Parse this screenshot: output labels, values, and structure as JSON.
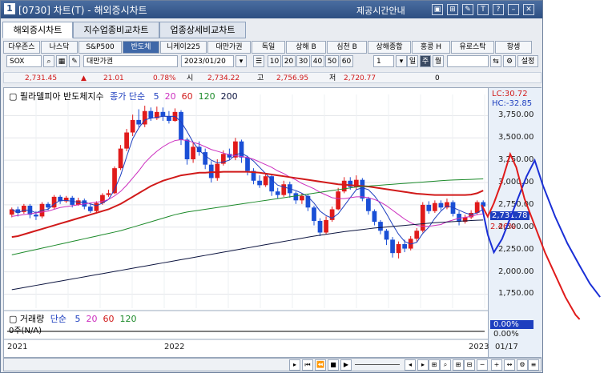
{
  "titlebar": {
    "num": "1",
    "title": "[0730] 차트(T) - 해외증시차트",
    "info": "제공시간안내",
    "icons": [
      "restore-icon",
      "link-icon",
      "tool-icon",
      "text-icon",
      "help-icon",
      "minimize-icon",
      "close-icon"
    ],
    "icon_glyphs": [
      "▣",
      "⊞",
      "✎",
      "T",
      "?",
      "–",
      "✕"
    ]
  },
  "tabs": [
    "해외증시차트",
    "지수업종비교차트",
    "업종상세비교차트"
  ],
  "markets": [
    "다우존스",
    "나스닥",
    "S&P500",
    "반도체",
    "니케이225",
    "대만가권",
    "독일",
    "상해 B",
    "심천 B",
    "상해종합",
    "홍콩 H",
    "유로스탁",
    "항셍"
  ],
  "selected_market": "반도체",
  "controls": {
    "symbol": "SOX",
    "name": "대만가권",
    "date": "2023/01/20",
    "periods": [
      "10",
      "20",
      "30",
      "40",
      "50",
      "60"
    ],
    "count": "1",
    "day": "일",
    "week": "주",
    "month": "월"
  },
  "quote": {
    "price": "2,731.45",
    "arrow": "▲",
    "change": "21.01",
    "rate": "0.78%",
    "open_label": "시",
    "open": "2,734.22",
    "high_label": "고",
    "high": "2,756.95",
    "low_label": "저",
    "low": "2,720.77",
    "volume": "0"
  },
  "legend": {
    "title": "필라델피아 반도체지수",
    "type": "종가 단순",
    "ma": [
      "5",
      "20",
      "60",
      "120",
      "200"
    ],
    "ma_colors": [
      "#1e3fbf",
      "#cc2fbf",
      "#d11a1a",
      "#1c8a2a",
      "#0d1540"
    ]
  },
  "axis_labels": {
    "lc": "LC:30.72",
    "hc": "HC:-32.85",
    "price_tag": "2,731.78",
    "pct_tag": "2.46%",
    "vol_pct": "0.00%",
    "vol_pct2": "0.00%",
    "date_tag": "01/17"
  },
  "y_ticks": [
    "3,750.00",
    "3,500.00",
    "3,250.00",
    "3,000.00",
    "2,750.00",
    "2,500.00",
    "2,250.00",
    "2,000.00",
    "1,750.00"
  ],
  "x_ticks": [
    "2021",
    "2022",
    "2023"
  ],
  "volume_legend": {
    "title": "거래량",
    "type": "단순",
    "ma": [
      "5",
      "20",
      "60",
      "120"
    ],
    "value": "0주(N/A)"
  },
  "chart_data": {
    "type": "candlestick",
    "title": "필라델피아 반도체지수",
    "y_range": [
      1620,
      3950
    ],
    "candles": [
      [
        2640,
        2700,
        2610,
        2720
      ],
      [
        2700,
        2660,
        2620,
        2730
      ],
      [
        2670,
        2740,
        2650,
        2760
      ],
      [
        2740,
        2640,
        2600,
        2760
      ],
      [
        2640,
        2620,
        2580,
        2680
      ],
      [
        2620,
        2760,
        2600,
        2780
      ],
      [
        2760,
        2720,
        2690,
        2780
      ],
      [
        2720,
        2840,
        2700,
        2860
      ],
      [
        2840,
        2790,
        2760,
        2860
      ],
      [
        2790,
        2830,
        2770,
        2850
      ],
      [
        2830,
        2750,
        2720,
        2850
      ],
      [
        2750,
        2800,
        2740,
        2830
      ],
      [
        2800,
        2730,
        2700,
        2820
      ],
      [
        2730,
        2680,
        2660,
        2760
      ],
      [
        2680,
        2770,
        2660,
        2790
      ],
      [
        2770,
        2860,
        2750,
        2880
      ],
      [
        2860,
        2880,
        2840,
        2920
      ],
      [
        2880,
        3160,
        2870,
        3180
      ],
      [
        3160,
        3380,
        3140,
        3420
      ],
      [
        3380,
        3560,
        3350,
        3600
      ],
      [
        3560,
        3700,
        3520,
        3760
      ],
      [
        3700,
        3650,
        3620,
        3820
      ],
      [
        3650,
        3800,
        3620,
        3860
      ],
      [
        3800,
        3720,
        3690,
        3840
      ],
      [
        3720,
        3790,
        3700,
        3850
      ],
      [
        3790,
        3740,
        3690,
        3840
      ],
      [
        3740,
        3690,
        3660,
        3800
      ],
      [
        3690,
        3790,
        3680,
        3830
      ],
      [
        3790,
        3480,
        3420,
        3810
      ],
      [
        3480,
        3260,
        3200,
        3500
      ],
      [
        3260,
        3400,
        3220,
        3450
      ],
      [
        3400,
        3340,
        3300,
        3460
      ],
      [
        3340,
        3200,
        3150,
        3380
      ],
      [
        3200,
        3050,
        3000,
        3240
      ],
      [
        3050,
        3210,
        3020,
        3260
      ],
      [
        3210,
        3320,
        3190,
        3360
      ],
      [
        3320,
        3280,
        3250,
        3380
      ],
      [
        3280,
        3460,
        3250,
        3500
      ],
      [
        3460,
        3280,
        3220,
        3480
      ],
      [
        3280,
        3130,
        3080,
        3300
      ],
      [
        3130,
        3020,
        2980,
        3160
      ],
      [
        3020,
        2970,
        2940,
        3080
      ],
      [
        2970,
        3070,
        2950,
        3100
      ],
      [
        3070,
        2900,
        2850,
        3090
      ],
      [
        2900,
        2860,
        2820,
        2940
      ],
      [
        2860,
        2980,
        2840,
        3020
      ],
      [
        2980,
        2880,
        2830,
        3010
      ],
      [
        2880,
        2800,
        2760,
        2900
      ],
      [
        2800,
        2850,
        2760,
        2880
      ],
      [
        2850,
        2720,
        2680,
        2870
      ],
      [
        2720,
        2570,
        2520,
        2740
      ],
      [
        2570,
        2440,
        2400,
        2600
      ],
      [
        2440,
        2580,
        2420,
        2620
      ],
      [
        2580,
        2700,
        2560,
        2730
      ],
      [
        2700,
        2900,
        2690,
        2940
      ],
      [
        2900,
        3020,
        2880,
        3060
      ],
      [
        3020,
        2950,
        2920,
        3060
      ],
      [
        2950,
        3030,
        2920,
        3080
      ],
      [
        3030,
        2820,
        2790,
        3050
      ],
      [
        2820,
        2680,
        2640,
        2840
      ],
      [
        2680,
        2560,
        2520,
        2700
      ],
      [
        2560,
        2460,
        2420,
        2580
      ],
      [
        2460,
        2360,
        2300,
        2480
      ],
      [
        2360,
        2210,
        2160,
        2390
      ],
      [
        2210,
        2310,
        2150,
        2340
      ],
      [
        2310,
        2260,
        2220,
        2360
      ],
      [
        2260,
        2370,
        2240,
        2400
      ],
      [
        2370,
        2460,
        2340,
        2490
      ],
      [
        2460,
        2750,
        2440,
        2780
      ],
      [
        2750,
        2680,
        2650,
        2790
      ],
      [
        2680,
        2770,
        2660,
        2800
      ],
      [
        2770,
        2720,
        2690,
        2800
      ],
      [
        2720,
        2780,
        2700,
        2820
      ],
      [
        2780,
        2650,
        2620,
        2800
      ],
      [
        2650,
        2560,
        2520,
        2680
      ],
      [
        2560,
        2610,
        2540,
        2640
      ],
      [
        2610,
        2660,
        2590,
        2690
      ],
      [
        2660,
        2780,
        2640,
        2800
      ],
      [
        2780,
        2731,
        2720,
        2800
      ]
    ],
    "ma_series": {
      "ma5": [
        2700,
        2660,
        2690,
        2690,
        2660,
        2690,
        2700,
        2760,
        2800,
        2800,
        2790,
        2780,
        2780,
        2760,
        2740,
        2770,
        2810,
        2920,
        3080,
        3290,
        3490,
        3610,
        3700,
        3720,
        3730,
        3740,
        3740,
        3740,
        3680,
        3570,
        3450,
        3360,
        3300,
        3250,
        3220,
        3230,
        3250,
        3310,
        3330,
        3290,
        3240,
        3170,
        3100,
        3030,
        2970,
        2950,
        2930,
        2910,
        2880,
        2840,
        2770,
        2680,
        2630,
        2600,
        2650,
        2740,
        2830,
        2920,
        2940,
        2920,
        2850,
        2760,
        2650,
        2530,
        2420,
        2340,
        2310,
        2330,
        2430,
        2500,
        2600,
        2680,
        2740,
        2720,
        2690,
        2660,
        2640,
        2660,
        2700
      ],
      "ma20": [
        2620,
        2630,
        2640,
        2650,
        2660,
        2670,
        2680,
        2700,
        2720,
        2730,
        2740,
        2750,
        2760,
        2770,
        2780,
        2790,
        2810,
        2850,
        2900,
        2970,
        3050,
        3130,
        3220,
        3290,
        3350,
        3400,
        3440,
        3470,
        3480,
        3470,
        3450,
        3430,
        3400,
        3370,
        3350,
        3330,
        3310,
        3300,
        3290,
        3280,
        3260,
        3230,
        3200,
        3170,
        3130,
        3100,
        3060,
        3030,
        2990,
        2960,
        2930,
        2890,
        2860,
        2830,
        2820,
        2820,
        2830,
        2840,
        2840,
        2830,
        2810,
        2780,
        2740,
        2690,
        2640,
        2590,
        2550,
        2520,
        2510,
        2510,
        2520,
        2530,
        2560,
        2580,
        2600,
        2610,
        2620,
        2640,
        2650
      ],
      "ma60": [
        2390,
        2400,
        2420,
        2440,
        2460,
        2480,
        2500,
        2520,
        2540,
        2560,
        2580,
        2600,
        2620,
        2640,
        2660,
        2680,
        2700,
        2730,
        2760,
        2800,
        2840,
        2880,
        2920,
        2960,
        2990,
        3020,
        3040,
        3060,
        3080,
        3090,
        3100,
        3110,
        3110,
        3115,
        3115,
        3120,
        3120,
        3120,
        3120,
        3120,
        3115,
        3110,
        3100,
        3090,
        3080,
        3070,
        3060,
        3050,
        3040,
        3030,
        3020,
        3010,
        3000,
        2990,
        2980,
        2975,
        2970,
        2965,
        2960,
        2955,
        2945,
        2935,
        2925,
        2915,
        2905,
        2895,
        2885,
        2875,
        2870,
        2865,
        2860,
        2860,
        2860,
        2860,
        2860,
        2860,
        2865,
        2880,
        2910
      ],
      "ma120": [
        2190,
        2205,
        2220,
        2235,
        2250,
        2265,
        2280,
        2295,
        2310,
        2325,
        2340,
        2355,
        2370,
        2385,
        2400,
        2415,
        2430,
        2445,
        2460,
        2480,
        2500,
        2520,
        2540,
        2560,
        2580,
        2600,
        2620,
        2640,
        2655,
        2670,
        2680,
        2690,
        2700,
        2710,
        2720,
        2730,
        2740,
        2750,
        2760,
        2770,
        2780,
        2790,
        2800,
        2810,
        2820,
        2830,
        2840,
        2850,
        2860,
        2870,
        2880,
        2890,
        2900,
        2910,
        2920,
        2930,
        2940,
        2950,
        2955,
        2960,
        2965,
        2970,
        2975,
        2980,
        2985,
        2990,
        2995,
        3000,
        3005,
        3010,
        3015,
        3020,
        3025,
        3028,
        3030,
        3033,
        3035,
        3038,
        3040
      ],
      "ma200": [
        1800,
        1812,
        1824,
        1836,
        1848,
        1860,
        1872,
        1884,
        1896,
        1908,
        1920,
        1932,
        1944,
        1956,
        1968,
        1980,
        1992,
        2004,
        2016,
        2028,
        2040,
        2052,
        2064,
        2076,
        2088,
        2100,
        2112,
        2124,
        2136,
        2148,
        2160,
        2172,
        2184,
        2196,
        2208,
        2220,
        2232,
        2244,
        2256,
        2268,
        2280,
        2292,
        2304,
        2316,
        2328,
        2340,
        2352,
        2364,
        2376,
        2388,
        2400,
        2410,
        2420,
        2430,
        2440,
        2450,
        2458,
        2466,
        2474,
        2482,
        2490,
        2496,
        2502,
        2508,
        2514,
        2520,
        2526,
        2532,
        2538,
        2544,
        2550,
        2554,
        2558,
        2562,
        2566,
        2570,
        2574,
        2578,
        2580
      ]
    },
    "projection": {
      "blue": [
        [
          2731,
          0
        ],
        [
          2400,
          3
        ],
        [
          2200,
          6
        ],
        [
          2350,
          10
        ],
        [
          2700,
          16
        ],
        [
          3050,
          22
        ],
        [
          3230,
          26
        ],
        [
          2950,
          30
        ],
        [
          2600,
          36
        ],
        [
          2300,
          42
        ],
        [
          2050,
          48
        ],
        [
          1850,
          53
        ],
        [
          1700,
          58
        ]
      ],
      "red": [
        [
          2731,
          0
        ],
        [
          2600,
          3
        ],
        [
          2750,
          6
        ],
        [
          3000,
          10
        ],
        [
          3300,
          14
        ],
        [
          3150,
          17
        ],
        [
          2800,
          21
        ],
        [
          2500,
          26
        ],
        [
          2200,
          31
        ],
        [
          1950,
          36
        ],
        [
          1700,
          41
        ],
        [
          1500,
          46
        ],
        [
          1450,
          48
        ]
      ]
    },
    "xlabels": [
      "2021",
      "2022",
      "2023"
    ]
  }
}
